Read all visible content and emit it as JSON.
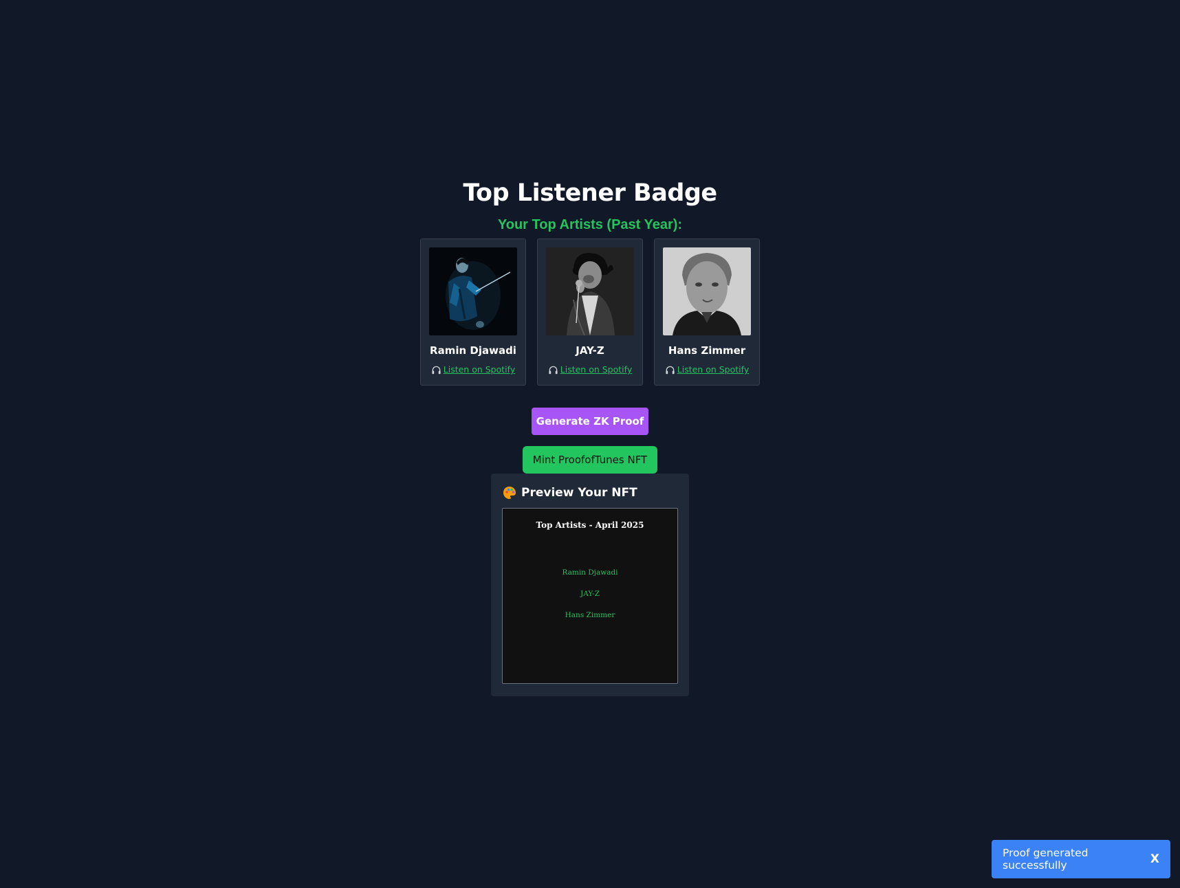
{
  "header": {
    "title": "Top Listener Badge",
    "subtitle": "Your Top Artists (Past Year):"
  },
  "artists": [
    {
      "name": "Ramin Djawadi",
      "link_label": " Listen on Spotify",
      "icon": "headphones-icon"
    },
    {
      "name": "JAY-Z",
      "link_label": " Listen on Spotify",
      "icon": "headphones-icon"
    },
    {
      "name": "Hans Zimmer",
      "link_label": " Listen on Spotify",
      "icon": "headphones-icon"
    }
  ],
  "actions": {
    "generate_label": "Generate ZK Proof",
    "mint_label": "Mint ProofofTunes NFT"
  },
  "preview": {
    "heading": "Preview Your NFT",
    "icon": "palette-icon",
    "nft": {
      "title": "Top Artists - April 2025",
      "artists": [
        "Ramin Djawadi",
        "JAY-Z",
        "Hans Zimmer"
      ]
    }
  },
  "toast": {
    "message": "Proof generated successfully",
    "close_label": "X"
  },
  "colors": {
    "background": "#111827",
    "card": "#1f2937",
    "accent_green": "#22c55e",
    "accent_purple": "#a855f7",
    "toast_blue": "#3b82f6"
  }
}
